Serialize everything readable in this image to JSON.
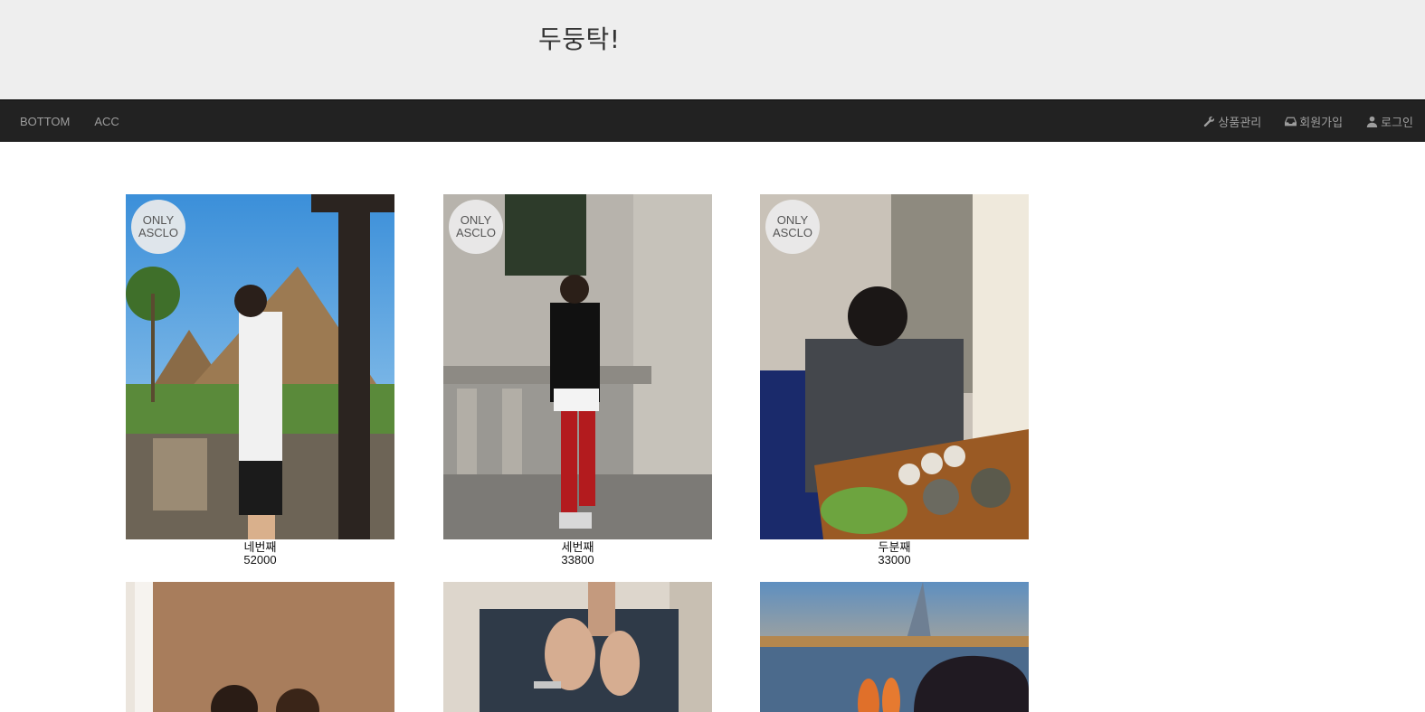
{
  "header": {
    "title": "두둥탁!"
  },
  "nav": {
    "left": [
      {
        "label": "BOTTOM"
      },
      {
        "label": "ACC"
      }
    ],
    "right": [
      {
        "label": "상품관리",
        "icon": "wrench-icon"
      },
      {
        "label": "회원가입",
        "icon": "inbox-icon"
      },
      {
        "label": "로그인",
        "icon": "user-icon"
      }
    ]
  },
  "badge": {
    "line1": "ONLY",
    "line2": "ASCLO"
  },
  "products": [
    {
      "name": "네번째",
      "price": "52000"
    },
    {
      "name": "세번째",
      "price": "33800"
    },
    {
      "name": "두분째",
      "price": "33000"
    },
    {
      "name": "",
      "price": ""
    },
    {
      "name": "",
      "price": ""
    },
    {
      "name": "",
      "price": ""
    }
  ],
  "colors": {
    "navbar": "#222222",
    "header": "#eeeeee",
    "nav_text": "#9d9d9d"
  }
}
